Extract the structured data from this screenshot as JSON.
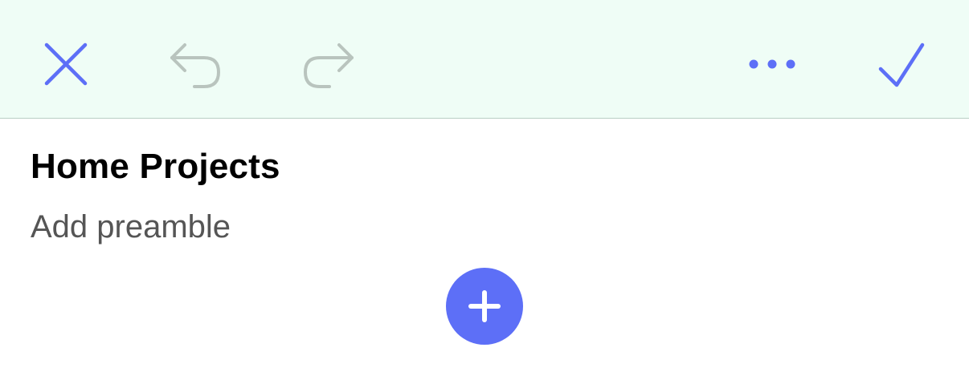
{
  "toolbar": {
    "close_icon": "close-icon",
    "undo_icon": "undo-icon",
    "redo_icon": "redo-icon",
    "more_icon": "more-icon",
    "done_icon": "checkmark-icon"
  },
  "note": {
    "title": "Home Projects",
    "preamble_placeholder": "Add preamble"
  },
  "add_button": {
    "icon": "plus-icon"
  },
  "colors": {
    "accent": "#5d6ff7",
    "disabled_icon": "#b9c4be",
    "toolbar_background": "#effdf6",
    "toolbar_border": "#b9cfc4",
    "placeholder_text": "#555555"
  }
}
